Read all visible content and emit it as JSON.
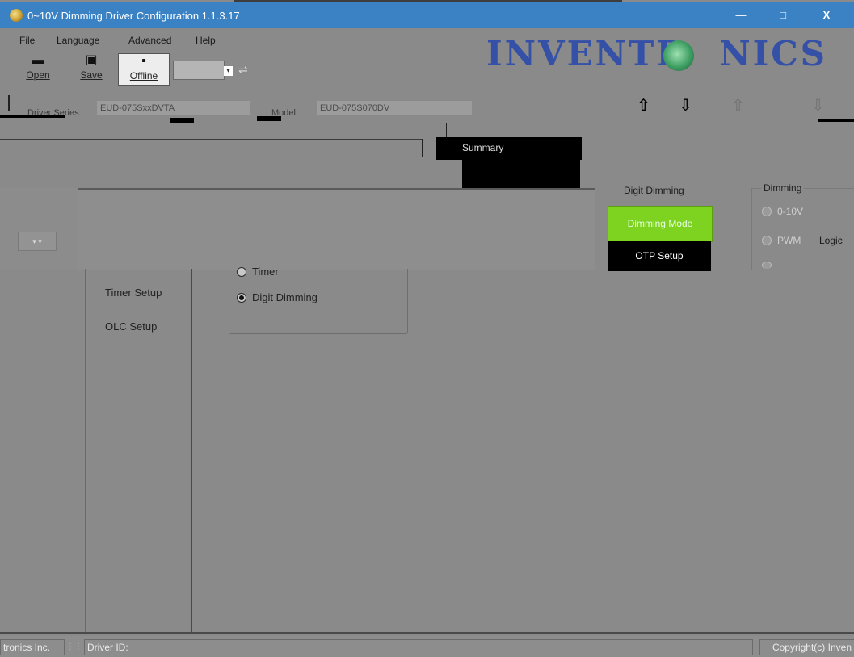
{
  "window": {
    "title": "0~10V Dimming Driver Configuration 1.1.3.17",
    "minimize": "—",
    "maximize": "□",
    "close": "X"
  },
  "menu": [
    "File",
    "Language",
    "Advanced",
    "Help"
  ],
  "toolbar": {
    "open": "Open",
    "save": "Save",
    "offline": "Offline",
    "usb_icon": "usb-icon"
  },
  "logo": {
    "left": "INVENTR",
    "right": "NICS"
  },
  "info": {
    "driver_label": "Driver Series:",
    "driver_value": "EUD-075SxxDVTA",
    "model_label": "Model:",
    "model_value": "EUD-075S070DV"
  },
  "tabs": {
    "summary": "Summary"
  },
  "left": {
    "combo_value": "▾ ▾",
    "nav": [
      "Timer Setup",
      "OLC Setup"
    ]
  },
  "mode_group": {
    "options": [
      {
        "label": "Timer",
        "checked": false
      },
      {
        "label": "Digit Dimming",
        "checked": true
      }
    ]
  },
  "right": {
    "group_title": "Digit Dimming",
    "buttons": [
      "Dimming Mode",
      "OTP Setup"
    ],
    "dimming_title": "Dimming",
    "dimming_options": [
      "0-10V",
      "PWM"
    ],
    "logic_label": "Logic"
  },
  "status": {
    "company": "tronics Inc.",
    "driver_id": "Driver ID:",
    "copyright": "Copyright(c) Inven"
  },
  "colors": {
    "titlebar": "#3b82c4",
    "logo": "#3450a7",
    "active_button": "#7ed321"
  }
}
